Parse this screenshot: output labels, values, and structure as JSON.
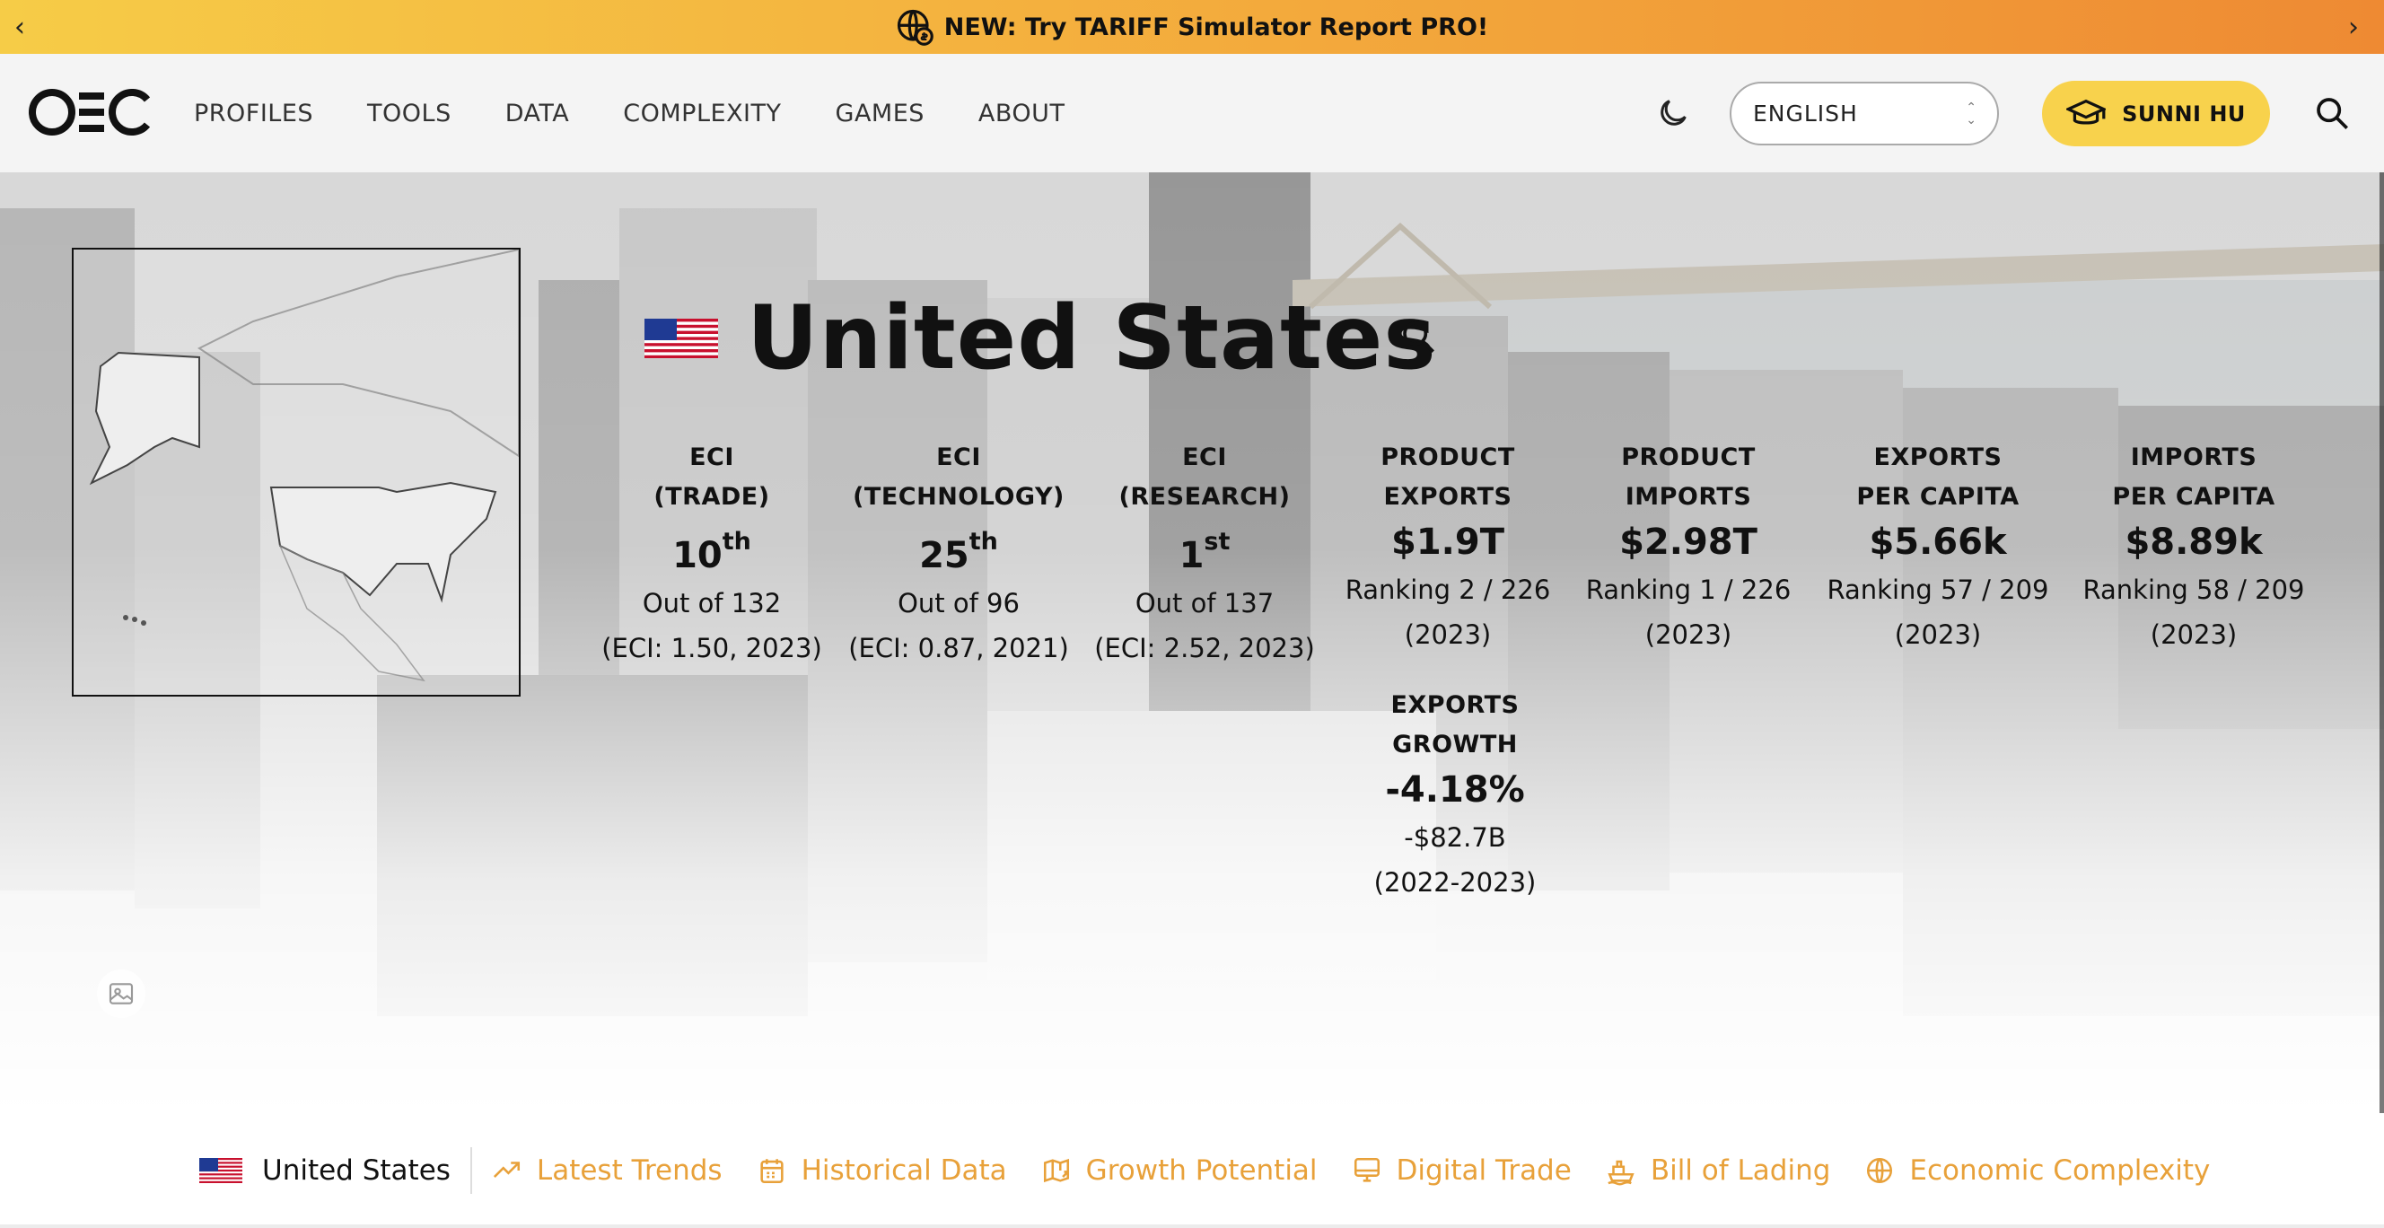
{
  "announcement": {
    "text": "NEW: Try TARIFF Simulator Report PRO!",
    "prev_icon": "chevron-left-icon",
    "next_icon": "chevron-right-icon",
    "icon": "globe-dollar-icon"
  },
  "header": {
    "logo": "OEC",
    "nav": [
      "PROFILES",
      "TOOLS",
      "DATA",
      "COMPLEXITY",
      "GAMES",
      "ABOUT"
    ],
    "theme_icon": "moon-icon",
    "language": "ENGLISH",
    "user_name": "SUNNI HU",
    "user_icon": "graduation-cap-icon",
    "search_icon": "search-icon"
  },
  "profile": {
    "country": "United States",
    "stats": [
      {
        "label_1": "ECI",
        "label_2": "(TRADE)",
        "rank": "10",
        "suffix": "th",
        "sub_1": "Out of 132",
        "sub_2": "(ECI: 1.50, 2023)"
      },
      {
        "label_1": "ECI",
        "label_2": "(TECHNOLOGY)",
        "rank": "25",
        "suffix": "th",
        "sub_1": "Out of 96",
        "sub_2": "(ECI: 0.87, 2021)"
      },
      {
        "label_1": "ECI",
        "label_2": "(RESEARCH)",
        "rank": "1",
        "suffix": "st",
        "sub_1": "Out of 137",
        "sub_2": "(ECI: 2.52, 2023)"
      },
      {
        "label_1": "PRODUCT",
        "label_2": "EXPORTS",
        "value": "$1.9T",
        "sub_1": "Ranking 2 / 226",
        "sub_2": "(2023)"
      },
      {
        "label_1": "PRODUCT",
        "label_2": "IMPORTS",
        "value": "$2.98T",
        "sub_1": "Ranking 1 / 226",
        "sub_2": "(2023)"
      },
      {
        "label_1": "EXPORTS",
        "label_2": "PER CAPITA",
        "value": "$5.66k",
        "sub_1": "Ranking 57 / 209",
        "sub_2": "(2023)"
      },
      {
        "label_1": "IMPORTS",
        "label_2": "PER CAPITA",
        "value": "$8.89k",
        "sub_1": "Ranking 58 / 209",
        "sub_2": "(2023)"
      },
      {
        "label_1": "EXPORTS",
        "label_2": "GROWTH",
        "value": "-4.18%",
        "sub_1": "-$82.7B",
        "sub_2": "(2022-2023)"
      }
    ]
  },
  "subnav": {
    "country": "United States",
    "items": [
      {
        "label": "Latest Trends",
        "icon": "trending-up-icon"
      },
      {
        "label": "Historical Data",
        "icon": "calendar-icon"
      },
      {
        "label": "Growth Potential",
        "icon": "map-arrow-icon"
      },
      {
        "label": "Digital Trade",
        "icon": "monitor-icon"
      },
      {
        "label": "Bill of Lading",
        "icon": "ship-icon"
      },
      {
        "label": "Economic Complexity",
        "icon": "globe-icon"
      }
    ]
  },
  "colors": {
    "accent": "#f8d24c",
    "link": "#e8a13a",
    "banner_start": "#f6cc47",
    "banner_end": "#ee8a33"
  }
}
